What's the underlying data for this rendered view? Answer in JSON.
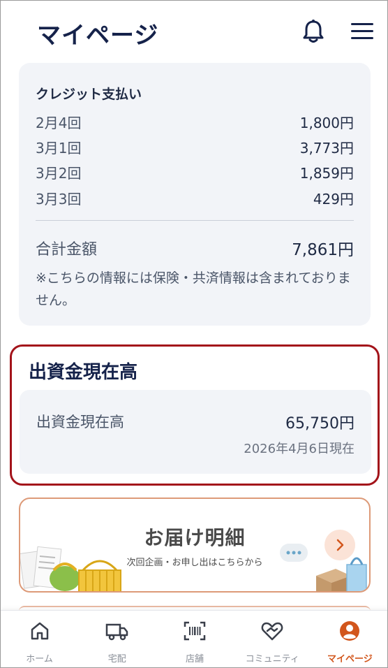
{
  "header": {
    "title": "マイページ",
    "bell_icon": "bell-icon",
    "menu_icon": "hamburger-menu-icon"
  },
  "credit": {
    "title": "クレジット支払い",
    "rows": [
      {
        "label": "2月4回",
        "amount": "1,800円"
      },
      {
        "label": "3月1回",
        "amount": "3,773円"
      },
      {
        "label": "3月2回",
        "amount": "1,859円"
      },
      {
        "label": "3月3回",
        "amount": "429円"
      }
    ],
    "total_label": "合計金額",
    "total_amount": "7,861円",
    "note": "※こちらの情報には保険・共済情報は含まれておりません。"
  },
  "capital": {
    "title": "出資金現在高",
    "label": "出資金現在高",
    "amount": "65,750円",
    "as_of": "2026年4月6日現在"
  },
  "delivery_banner": {
    "title": "お届け明細",
    "subtitle": "次回企画・お申し出はこちらから",
    "arrow_icon": "chevron-right-icon"
  },
  "bottom_nav": [
    {
      "label": "ホーム",
      "icon": "home-icon",
      "active": false
    },
    {
      "label": "宅配",
      "icon": "truck-icon",
      "active": false
    },
    {
      "label": "店舗",
      "icon": "barcode-icon",
      "active": false
    },
    {
      "label": "コミュニティ",
      "icon": "heart-hands-icon",
      "active": false
    },
    {
      "label": "マイページ",
      "icon": "user-circle-icon",
      "active": true
    }
  ],
  "colors": {
    "navy": "#15224a",
    "card_bg": "#f2f4f8",
    "highlight_border": "#a3131a",
    "accent_orange": "#d2561c",
    "banner_border": "#dd9a78"
  }
}
